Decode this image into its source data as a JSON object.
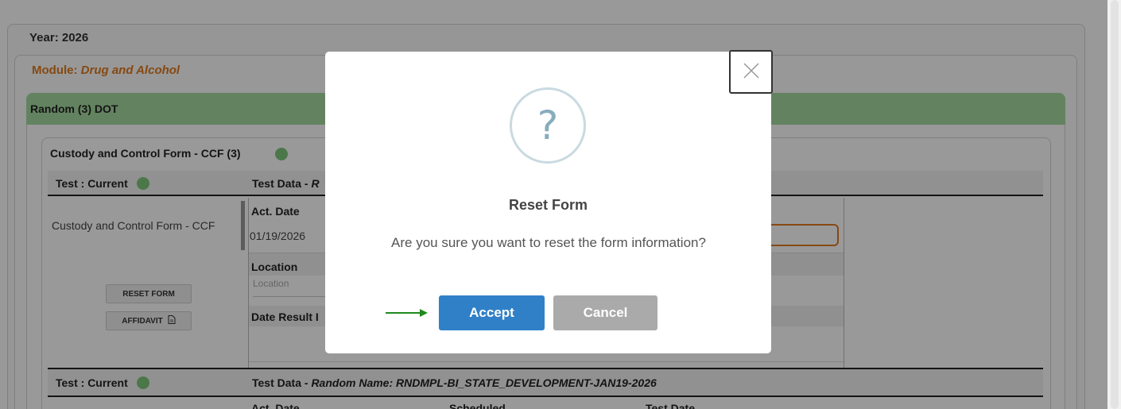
{
  "year": {
    "label": "Year: 2026"
  },
  "module": {
    "prefix": "Module: ",
    "name": "Drug and Alcohol"
  },
  "random_section": {
    "title": "Random (3) DOT"
  },
  "ccf_section": {
    "title": "Custody and Control Form - CCF (3)"
  },
  "table1": {
    "col1_header": "Test : Current",
    "col2_header_prefix": "Test Data - ",
    "col2_header_italic": "R",
    "row_label": "Custody and Control Form - CCF",
    "act_date_label": "Act. Date",
    "act_date_value": "01/19/2026",
    "location_label": "Location",
    "location_placeholder": "Location",
    "date_result_label": "Date Result I",
    "reset_form_button": "RESET FORM",
    "affidavit_button": "AFFIDAVIT"
  },
  "table2": {
    "col1_header": "Test : Current",
    "col2_header_prefix": "Test Data - ",
    "col2_header_italic": "Random Name: RNDMPL-BI_STATE_DEVELOPMENT-JAN19-2026",
    "act_date_label": "Act. Date",
    "scheduled_label": "Scheduled",
    "test_date_label": "Test Date"
  },
  "modal": {
    "icon": "question-icon",
    "icon_glyph": "?",
    "close_glyph": "×",
    "title": "Reset Form",
    "message": "Are you sure you want to reset the form information?",
    "accept_label": "Accept",
    "cancel_label": "Cancel"
  },
  "colors": {
    "accent_orange": "#e07a1f",
    "header_green": "#a6dba0",
    "accept_blue": "#3080c8",
    "cancel_grey": "#aaaaaa",
    "arrow_green": "#1e8a1e"
  }
}
